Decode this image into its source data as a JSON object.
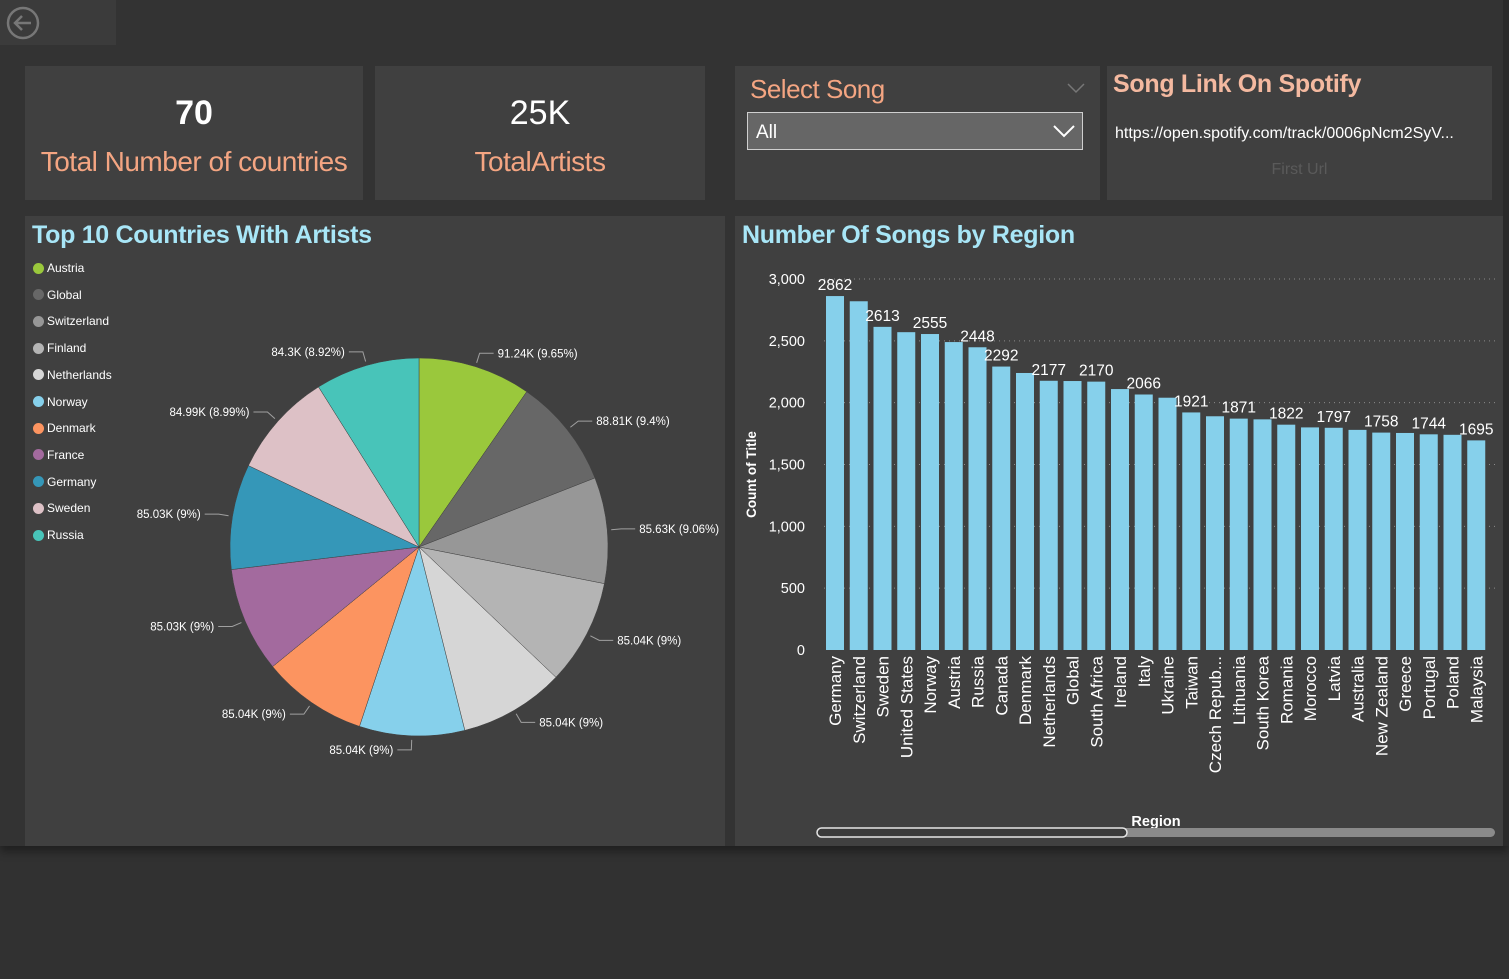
{
  "kpis": {
    "countries": {
      "value": "70",
      "label": "Total Number of countries"
    },
    "artists": {
      "value": "25K",
      "label": "TotalArtists"
    }
  },
  "slicer": {
    "title": "Select Song",
    "selected": "All"
  },
  "link_card": {
    "title": "Song Link On Spotify",
    "url": "https://open.spotify.com/track/0006pNcm2SyV...",
    "subtitle": "First Url"
  },
  "pie_chart": {
    "title": "Top 10 Countries With Artists"
  },
  "bar_chart": {
    "title": "Number Of Songs by Region"
  },
  "colors": {
    "accent_label": "#f4a582",
    "chart_title": "#a8e6f7",
    "bar": "#86d0eb"
  },
  "chart_data": [
    {
      "type": "pie",
      "title": "Top 10 Countries With Artists",
      "legend_position": "left",
      "slices": [
        {
          "name": "Austria",
          "value": 91.24,
          "label": "91.24K (9.65%)",
          "color": "#9ac83c"
        },
        {
          "name": "Global",
          "value": 88.81,
          "label": "88.81K (9.4%)",
          "color": "#676767"
        },
        {
          "name": "Switzerland",
          "value": 85.63,
          "label": "85.63K (9.06%)",
          "color": "#979797"
        },
        {
          "name": "Finland",
          "value": 85.04,
          "label": "85.04K (9%)",
          "color": "#b4b4b4"
        },
        {
          "name": "Netherlands",
          "value": 85.04,
          "label": "85.04K (9%)",
          "color": "#d6d6d6"
        },
        {
          "name": "Norway",
          "value": 85.04,
          "label": "85.04K (9%)",
          "color": "#86d0eb"
        },
        {
          "name": "Denmark",
          "value": 85.04,
          "label": "85.04K (9%)",
          "color": "#fc9460"
        },
        {
          "name": "France",
          "value": 85.03,
          "label": "85.03K (9%)",
          "color": "#a36a9e"
        },
        {
          "name": "Germany",
          "value": 85.03,
          "label": "85.03K (9%)",
          "color": "#3597b8"
        },
        {
          "name": "Sweden",
          "value": 84.99,
          "label": "84.99K (8.99%)",
          "color": "#ddc1c6"
        },
        {
          "name": "Russia",
          "value": 84.3,
          "label": "84.3K (8.92%)",
          "color": "#48c4b9"
        }
      ]
    },
    {
      "type": "bar",
      "title": "Number Of Songs by Region",
      "xlabel": "Region",
      "ylabel": "Count of Title",
      "ylim": [
        0,
        3000
      ],
      "yticks": [
        "0",
        "500",
        "1,000",
        "1,500",
        "2,000",
        "2,500",
        "3,000"
      ],
      "grid": true,
      "categories": [
        "Germany",
        "Switzerland",
        "Sweden",
        "United States",
        "Norway",
        "Austria",
        "Russia",
        "Canada",
        "Denmark",
        "Netherlands",
        "Global",
        "South Africa",
        "Ireland",
        "Italy",
        "Ukraine",
        "Taiwan",
        "Czech Repub...",
        "Lithuania",
        "South Korea",
        "Romania",
        "Morocco",
        "Latvia",
        "Australia",
        "New Zealand",
        "Greece",
        "Portugal",
        "Poland",
        "Malaysia"
      ],
      "values": [
        2862,
        2820,
        2613,
        2570,
        2555,
        2490,
        2448,
        2292,
        2240,
        2177,
        2175,
        2170,
        2110,
        2066,
        2040,
        1921,
        1890,
        1871,
        1865,
        1822,
        1800,
        1797,
        1780,
        1758,
        1755,
        1744,
        1740,
        1695
      ],
      "data_labels": [
        "2862",
        "",
        "2613",
        "",
        "2555",
        "",
        "2448",
        "2292",
        "",
        "2177",
        "",
        "2170",
        "",
        "2066",
        "",
        "1921",
        "",
        "1871",
        "",
        "1822",
        "",
        "1797",
        "",
        "1758",
        "",
        "1744",
        "",
        "1695"
      ]
    }
  ]
}
